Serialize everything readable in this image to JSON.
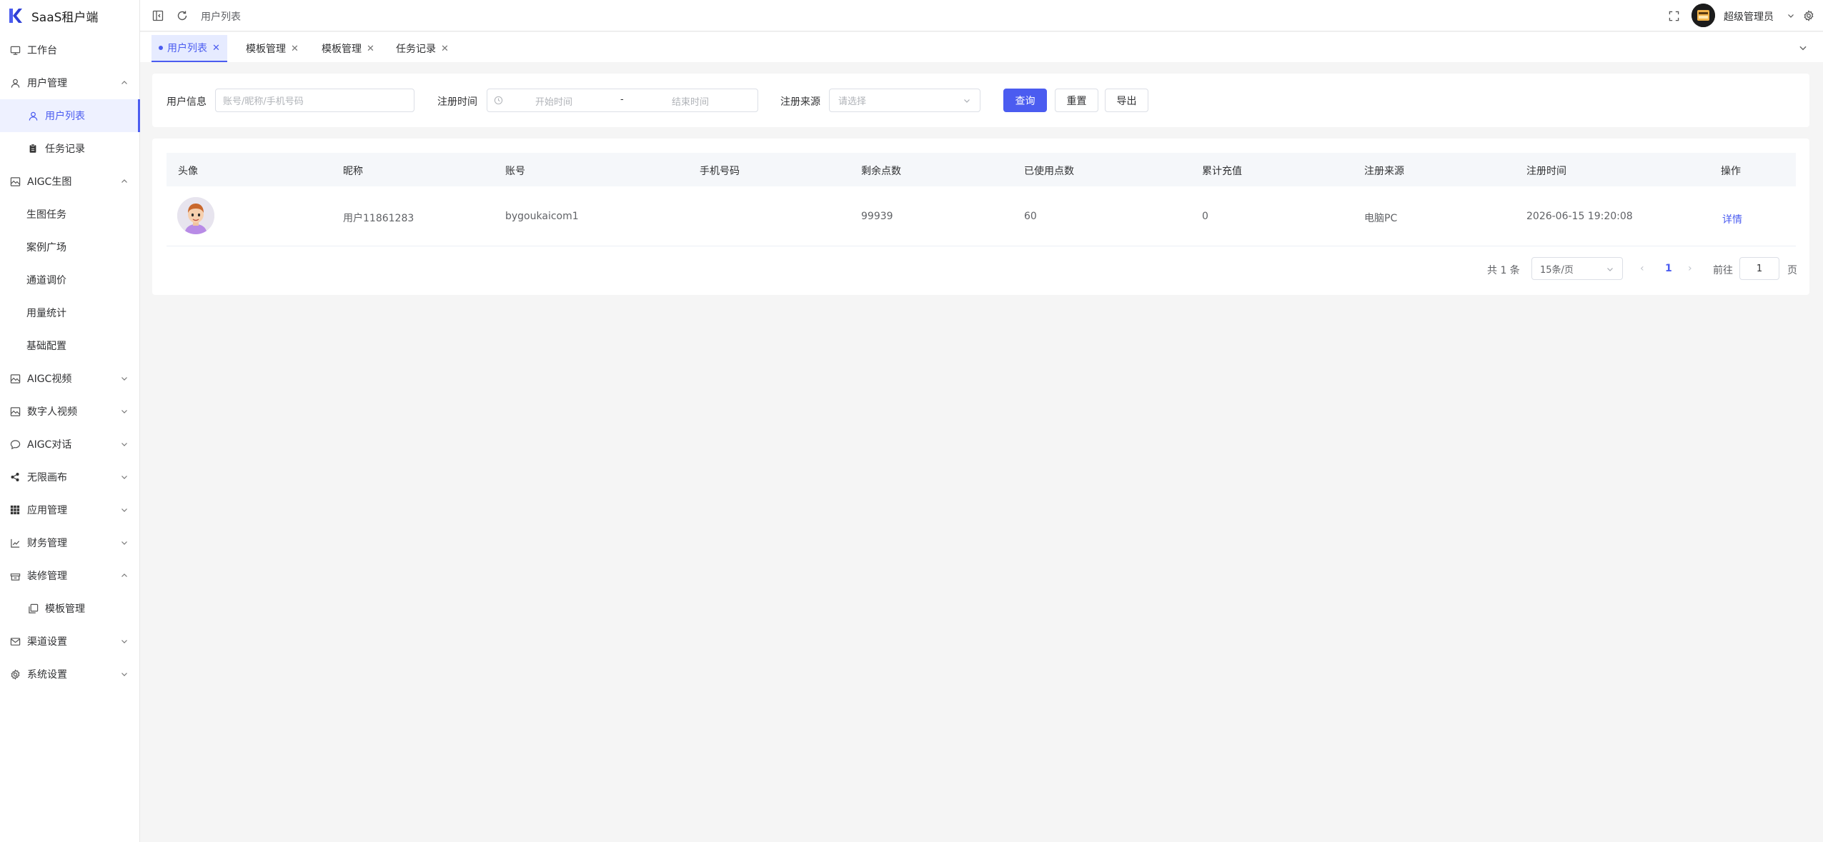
{
  "app": {
    "title": "SaaS租户端",
    "brand_color": "#4b5cf0"
  },
  "sidebar": {
    "items": [
      {
        "label": "工作台",
        "icon": "monitor-icon"
      },
      {
        "label": "用户管理",
        "icon": "user-icon",
        "expanded": true
      },
      {
        "label": "用户列表",
        "icon": "user-icon",
        "active": true
      },
      {
        "label": "任务记录",
        "icon": "clipboard-icon"
      },
      {
        "label": "AIGC生图",
        "icon": "image-icon",
        "expanded": true
      },
      {
        "label": "生图任务"
      },
      {
        "label": "案例广场"
      },
      {
        "label": "通道调价"
      },
      {
        "label": "用量统计"
      },
      {
        "label": "基础配置"
      },
      {
        "label": "AIGC视频",
        "icon": "image-icon"
      },
      {
        "label": "数字人视频",
        "icon": "image-icon"
      },
      {
        "label": "AIGC对话",
        "icon": "chat-icon"
      },
      {
        "label": "无限画布",
        "icon": "share-icon"
      },
      {
        "label": "应用管理",
        "icon": "grid-icon"
      },
      {
        "label": "财务管理",
        "icon": "chart-icon"
      },
      {
        "label": "装修管理",
        "icon": "box-icon",
        "expanded": true
      },
      {
        "label": "模板管理",
        "icon": "copy-icon"
      },
      {
        "label": "渠道设置",
        "icon": "mail-icon"
      },
      {
        "label": "系统设置",
        "icon": "gear-icon"
      }
    ]
  },
  "header": {
    "breadcrumb": "用户列表",
    "admin_name": "超级管理员"
  },
  "tabs": [
    {
      "label": "用户列表",
      "active": true
    },
    {
      "label": "模板管理"
    },
    {
      "label": "模板管理"
    },
    {
      "label": "任务记录"
    }
  ],
  "filters": {
    "user_info_label": "用户信息",
    "user_info_placeholder": "账号/昵称/手机号码",
    "reg_time_label": "注册时间",
    "start_placeholder": "开始时间",
    "range_sep": "-",
    "end_placeholder": "结束时间",
    "source_label": "注册来源",
    "source_placeholder": "请选择",
    "query_btn": "查询",
    "reset_btn": "重置",
    "export_btn": "导出"
  },
  "table": {
    "columns": [
      "头像",
      "昵称",
      "账号",
      "手机号码",
      "剩余点数",
      "已使用点数",
      "累计充值",
      "注册来源",
      "注册时间",
      "操作"
    ],
    "rows": [
      {
        "nickname": "用户11861283",
        "account": "bygoukaicom1",
        "phone": "",
        "remaining": "99939",
        "used": "60",
        "recharge": "0",
        "source": "电脑PC",
        "reg_time": "2026-06-15 19:20:08",
        "action": "详情"
      }
    ]
  },
  "pagination": {
    "total": "共 1 条",
    "page_size": "15条/页",
    "current": "1",
    "goto_prefix": "前往",
    "goto_value": "1",
    "goto_suffix": "页"
  }
}
